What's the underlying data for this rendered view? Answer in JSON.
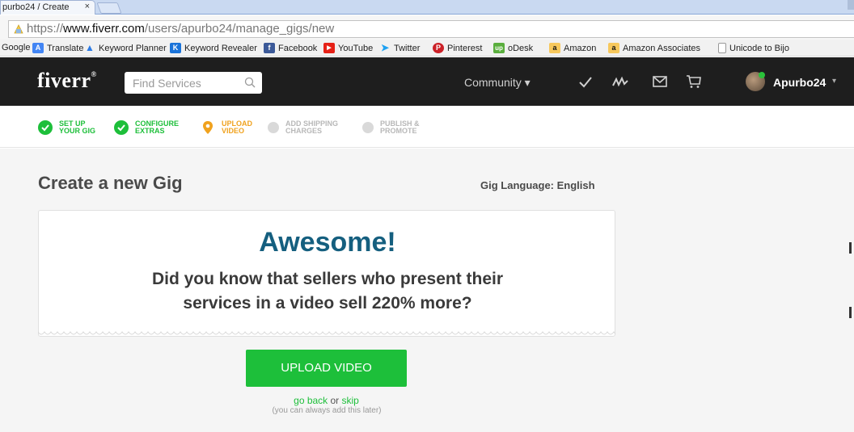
{
  "browser": {
    "tab_title": "purbo24 / Create",
    "tab_close": "×",
    "url_prefix": "https://",
    "url_domain": "www.fiverr.com",
    "url_path": "/users/apurbo24/manage_gigs/new"
  },
  "bookmarks": [
    {
      "label": "Google",
      "icon": "none"
    },
    {
      "label": "Translate",
      "icon": "translate-icon"
    },
    {
      "label": "Keyword Planner",
      "icon": "adwords-icon"
    },
    {
      "label": "Keyword Revealer",
      "icon": "keyword-revealer-icon"
    },
    {
      "label": "Facebook",
      "icon": "facebook-icon"
    },
    {
      "label": "YouTube",
      "icon": "youtube-icon"
    },
    {
      "label": "Twitter",
      "icon": "twitter-icon"
    },
    {
      "label": "Pinterest",
      "icon": "pinterest-icon"
    },
    {
      "label": "oDesk",
      "icon": "odesk-icon"
    },
    {
      "label": "Amazon",
      "icon": "amazon-icon"
    },
    {
      "label": "Amazon Associates",
      "icon": "amazon-icon"
    },
    {
      "label": "Unicode to Bijo",
      "icon": "page-icon"
    }
  ],
  "nav": {
    "logo": "fiverr",
    "logo_mark": "®",
    "search_placeholder": "Find Services",
    "community": "Community ▾",
    "username": "Apurbo24",
    "user_caret": "▾"
  },
  "steps": [
    {
      "label": "SET UP\nYOUR GIG",
      "state": "done"
    },
    {
      "label": "CONFIGURE\nEXTRAS",
      "state": "done"
    },
    {
      "label": "UPLOAD\nVIDEO",
      "state": "active"
    },
    {
      "label": "ADD SHIPPING\nCHARGES",
      "state": "todo"
    },
    {
      "label": "PUBLISH &\nPROMOTE",
      "state": "todo"
    }
  ],
  "main": {
    "title": "Create a new Gig",
    "language": "Gig Language: English",
    "headline": "Awesome!",
    "message_line1": "Did you know that sellers who present their",
    "message_line2": "services in a video sell 220% more?",
    "upload_button": "UPLOAD VIDEO",
    "go_back": "go back",
    "or": " or ",
    "skip": "skip",
    "hint": "(you can always add this later)"
  },
  "colors": {
    "accent": "#1dbf3a",
    "active_step": "#f0a21e",
    "headline": "#155f7f",
    "nav_bg": "#1e1e1e"
  }
}
